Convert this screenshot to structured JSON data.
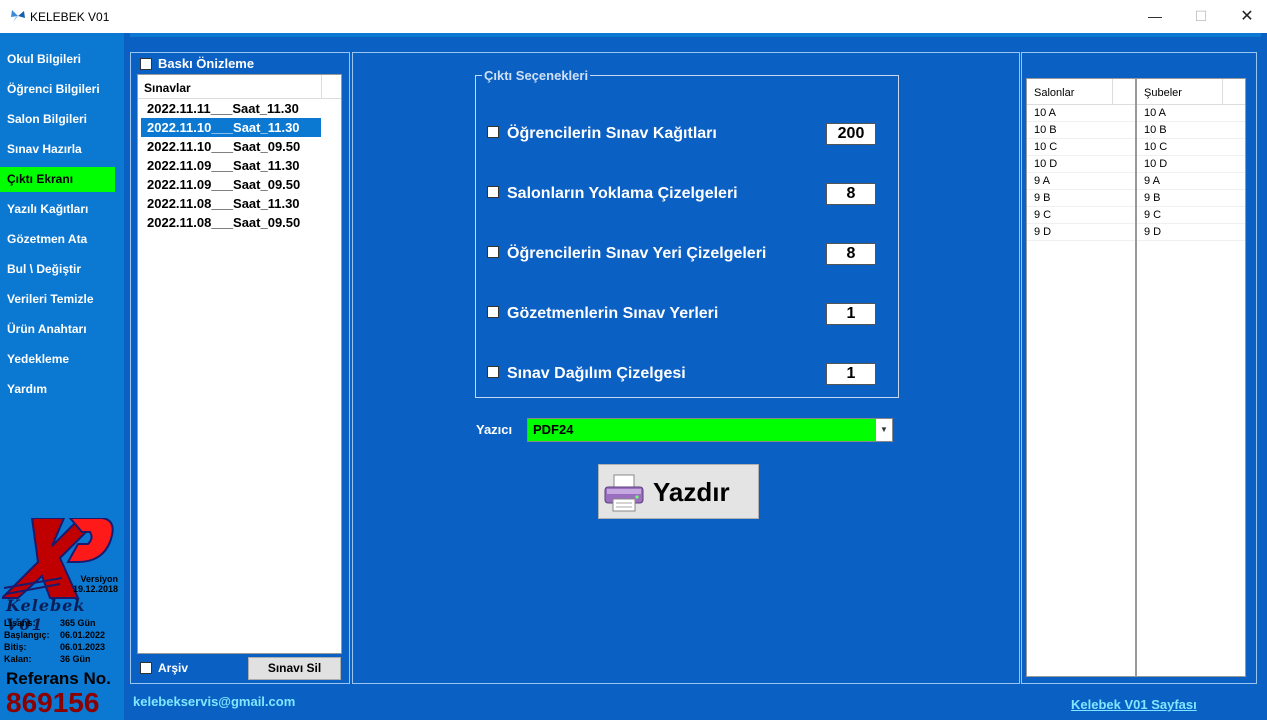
{
  "window": {
    "title": "KELEBEK V01",
    "minimize": "—",
    "maximize": "☐",
    "close": "✕"
  },
  "sidebar": {
    "items": [
      {
        "label": "Okul Bilgileri",
        "active": false
      },
      {
        "label": "Öğrenci Bilgileri",
        "active": false
      },
      {
        "label": "Salon Bilgileri",
        "active": false
      },
      {
        "label": "Sınav Hazırla",
        "active": false
      },
      {
        "label": "Çıktı Ekranı",
        "active": true
      },
      {
        "label": "Yazılı Kağıtları",
        "active": false
      },
      {
        "label": "Gözetmen Ata",
        "active": false
      },
      {
        "label": "Bul \\ Değiştir",
        "active": false
      },
      {
        "label": "Verileri Temizle",
        "active": false
      },
      {
        "label": "Ürün Anahtarı",
        "active": false
      },
      {
        "label": "Yedekleme",
        "active": false
      },
      {
        "label": "Yardım",
        "active": false
      }
    ],
    "logo_letters": "XP",
    "version_label": "Versiyon",
    "version_date": "19.12.2018",
    "brand": "Kelebek V01",
    "license": {
      "lisans_label": "Lisans:",
      "lisans_value": "365 Gün",
      "baslangic_label": "Başlangıç:",
      "baslangic_value": "06.01.2022",
      "bitis_label": "Bitiş:",
      "bitis_value": "06.01.2023",
      "kalan_label": "Kalan:",
      "kalan_value": "36 Gün"
    },
    "referans_label": "Referans No.",
    "referans_no": "869156"
  },
  "left_panel": {
    "preview_label": "Baskı Önizleme",
    "exams_header": "Sınavlar",
    "exams": [
      "2022.11.11___Saat_11.30",
      "2022.11.10___Saat_11.30",
      "2022.11.10___Saat_09.50",
      "2022.11.09___Saat_11.30",
      "2022.11.09___Saat_09.50",
      "2022.11.08___Saat_11.30",
      "2022.11.08___Saat_09.50"
    ],
    "selected_index": 1,
    "archive_label": "Arşiv",
    "delete_button": "Sınavı Sil"
  },
  "output_options": {
    "group_title": "Çıktı Seçenekleri",
    "options": [
      {
        "label": "Öğrencilerin Sınav Kağıtları",
        "value": "200"
      },
      {
        "label": "Salonların Yoklama Çizelgeleri",
        "value": "8"
      },
      {
        "label": "Öğrencilerin Sınav Yeri Çizelgeleri",
        "value": "8"
      },
      {
        "label": "Gözetmenlerin Sınav Yerleri",
        "value": "1"
      },
      {
        "label": "Sınav Dağılım Çizelgesi",
        "value": "1"
      }
    ],
    "printer_label": "Yazıcı",
    "printer_value": "PDF24",
    "print_button": "Yazdır"
  },
  "right_panel": {
    "salonlar_header": "Salonlar",
    "subeler_header": "Şubeler",
    "salonlar": [
      "10 A",
      "10 B",
      "10 C",
      "10 D",
      "9 A",
      "9 B",
      "9 C",
      "9 D"
    ],
    "subeler": [
      "10 A",
      "10 B",
      "10 C",
      "10 D",
      "9 A",
      "9 B",
      "9 C",
      "9 D"
    ]
  },
  "footer": {
    "email": "kelebekservis@gmail.com",
    "homepage_link": "Kelebek V01 Sayfası"
  },
  "colors": {
    "sidebar_bg": "#0b78d2",
    "main_bg": "#0b60c4",
    "active_green": "#00ff00",
    "link_cyan": "#7fe7ff",
    "ref_red": "#8b0000"
  }
}
